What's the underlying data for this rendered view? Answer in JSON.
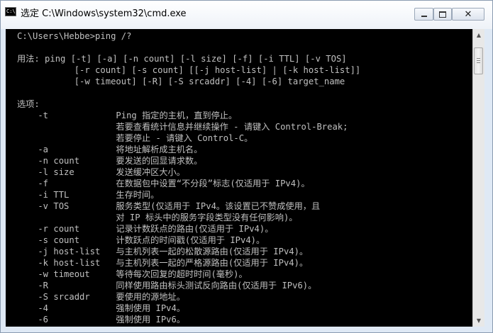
{
  "window": {
    "title": "选定 C:\\Windows\\system32\\cmd.exe",
    "icon_label": "C:\\",
    "controls": {
      "minimize": "minimize-icon",
      "maximize": "maximize-icon",
      "close": "close-icon",
      "close_glyph": "✕"
    }
  },
  "console": {
    "lines": [
      "C:\\Users\\Hebbe>ping /?",
      "",
      "用法: ping [-t] [-a] [-n count] [-l size] [-f] [-i TTL] [-v TOS]",
      "           [-r count] [-s count] [[-j host-list] | [-k host-list]]",
      "           [-w timeout] [-R] [-S srcaddr] [-4] [-6] target_name",
      "",
      "选项:",
      "    -t             Ping 指定的主机，直到停止。",
      "                   若要查看统计信息并继续操作 - 请键入 Control-Break;",
      "                   若要停止 - 请键入 Control-C。",
      "    -a             将地址解析成主机名。",
      "    -n count       要发送的回显请求数。",
      "    -l size        发送缓冲区大小。",
      "    -f             在数据包中设置“不分段”标志(仅适用于 IPv4)。",
      "    -i TTL         生存时间。",
      "    -v TOS         服务类型(仅适用于 IPv4。该设置已不赞成使用，且",
      "                   对 IP 标头中的服务字段类型没有任何影响)。",
      "    -r count       记录计数跃点的路由(仅适用于 IPv4)。",
      "    -s count       计数跃点的时间戳(仅适用于 IPv4)。",
      "    -j host-list   与主机列表一起的松散源路由(仅适用于 IPv4)。",
      "    -k host-list   与主机列表一起的严格源路由(仅适用于 IPv4)。",
      "    -w timeout     等待每次回复的超时时间(毫秒)。",
      "    -R             同样使用路由标头测试反向路由(仅适用于 IPv6)。",
      "    -S srcaddr     要使用的源地址。",
      "    -4             强制使用 IPv4。",
      "    -6             强制使用 IPv6。"
    ]
  },
  "scrollbar": {
    "up_glyph": "▲",
    "down_glyph": "▼",
    "position_fraction": 0.0
  },
  "colors": {
    "console_bg": "#000000",
    "console_fg": "#c0c0c0",
    "titlebar": "#eef2f8"
  }
}
